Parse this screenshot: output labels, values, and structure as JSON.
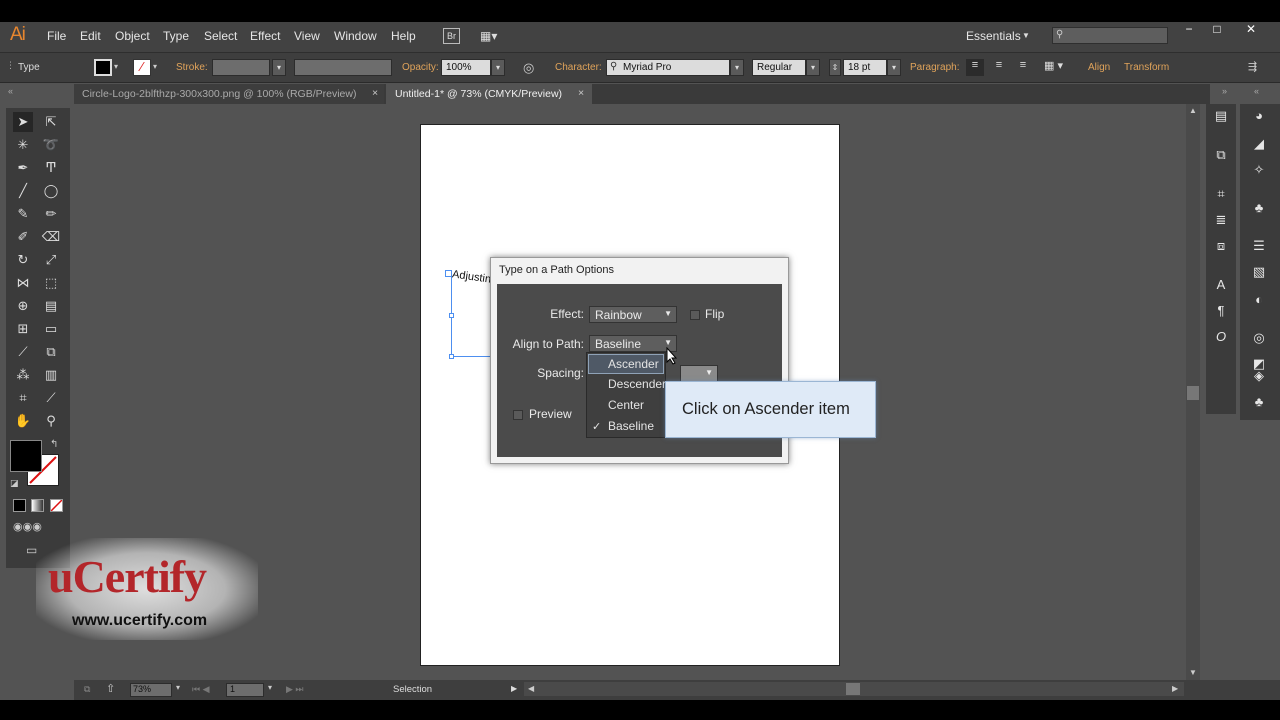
{
  "app": {
    "logo": "Ai",
    "accent": "#e7862f"
  },
  "menu": [
    "File",
    "Edit",
    "Object",
    "Type",
    "Select",
    "Effect",
    "View",
    "Window",
    "Help"
  ],
  "bridge_button": "Br",
  "workspace": {
    "label": "Essentials"
  },
  "control_bar": {
    "tool_name": "Type",
    "stroke_label": "Stroke:",
    "opacity_label": "Opacity:",
    "opacity_value": "100%",
    "character_label": "Character:",
    "font_value": "Myriad Pro",
    "style_value": "Regular",
    "size_value": "18 pt",
    "paragraph_label": "Paragraph:",
    "align_label": "Align",
    "transform_label": "Transform"
  },
  "tabs": [
    {
      "label": "Circle-Logo-2blfthzp-300x300.png @ 100% (RGB/Preview)",
      "close": "×"
    },
    {
      "label": "Untitled-1* @ 73% (CMYK/Preview)",
      "close": "×"
    }
  ],
  "path_text": "Adjustin",
  "dialog": {
    "title": "Type on a Path Options",
    "effect_label": "Effect:",
    "effect_value": "Rainbow",
    "flip_label": "Flip",
    "align_label": "Align to Path:",
    "align_value": "Baseline",
    "spacing_label": "Spacing:",
    "preview_label": "Preview"
  },
  "dropdown": {
    "items": [
      "Ascender",
      "Descender",
      "Center",
      "Baseline"
    ],
    "checked": "Baseline",
    "check_mark": "✓"
  },
  "callout": {
    "text": "Click on Ascender item"
  },
  "status": {
    "zoom": "73%",
    "page": "1",
    "tool": "Selection"
  },
  "watermark": {
    "brand": "uCertify",
    "url": "www.ucertify.com"
  }
}
